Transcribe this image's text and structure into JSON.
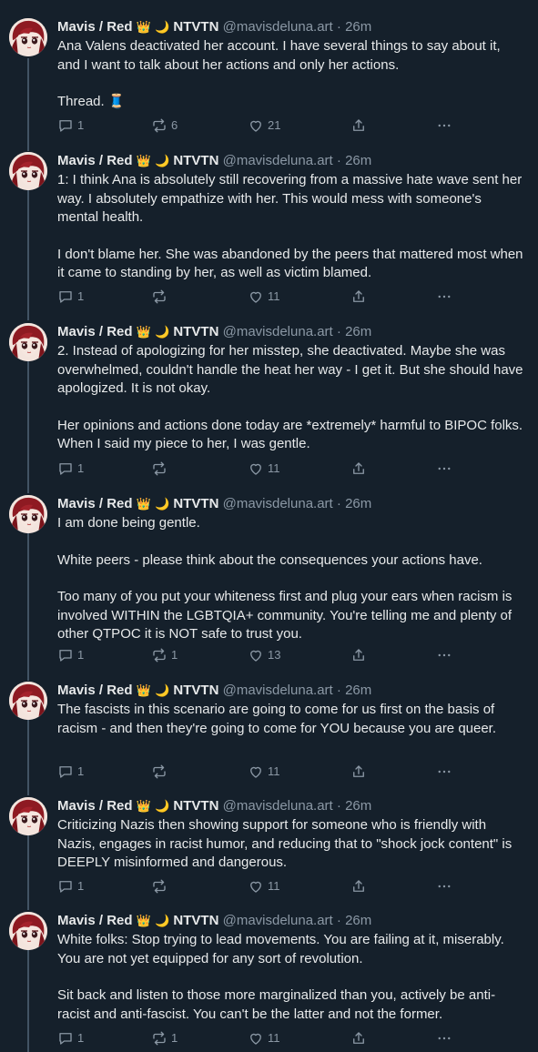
{
  "author": {
    "name": "Mavis / Red",
    "badge_emojis": [
      "👑",
      "🌙"
    ],
    "badge_text": "NTVTN",
    "handle": "@mavisdeluna.art",
    "separator": "·",
    "time": "26m"
  },
  "icons": {
    "reply": "reply-icon",
    "retweet": "retweet-icon",
    "like": "heart-icon",
    "share": "share-icon",
    "more": "more-icon"
  },
  "colors": {
    "background": "#15202b",
    "text": "#e7e9ea",
    "muted": "#8b98a5",
    "thread_line": "#425364"
  },
  "posts": [
    {
      "paragraphs": [
        "Ana Valens deactivated her account. I have several things to say about it, and I want to talk about her actions and only her actions.",
        "Thread. 🧵"
      ],
      "replies": "1",
      "retweets": "6",
      "likes": "21"
    },
    {
      "paragraphs": [
        "1: I think Ana is absolutely still recovering from a massive hate wave sent her way. I absolutely empathize with her. This would mess with someone's mental health.",
        "I don't blame her. She was abandoned by the peers that mattered most when it came to standing by her, as well as victim blamed."
      ],
      "replies": "1",
      "retweets": "",
      "likes": "11"
    },
    {
      "paragraphs": [
        "2. Instead of apologizing for her misstep, she deactivated. Maybe she was overwhelmed, couldn't handle the heat her way - I get it. But she should have apologized. It is not okay.",
        "Her opinions and actions done today are *extremely* harmful to BIPOC folks. When I said my piece to her, I was gentle."
      ],
      "replies": "1",
      "retweets": "",
      "likes": "11"
    },
    {
      "paragraphs": [
        "I am done being gentle.",
        "White peers - please think about the consequences your actions have.",
        "Too many of you put your whiteness first and plug your ears when racism is involved WITHIN the LGBTQIA+ community. You're telling me and plenty of other QTPOC it is NOT safe to trust you."
      ],
      "replies": "1",
      "retweets": "1",
      "likes": "13"
    },
    {
      "paragraphs": [
        "The fascists in this scenario are going to come for us first on the basis of racism - and then they're going to come for YOU because you are queer."
      ],
      "replies": "1",
      "retweets": "",
      "likes": "11"
    },
    {
      "paragraphs": [
        "Criticizing Nazis then showing support for someone who is friendly with Nazis, engages in racist humor, and reducing that to \"shock jock content\" is DEEPLY misinformed and dangerous."
      ],
      "replies": "1",
      "retweets": "",
      "likes": "11"
    },
    {
      "paragraphs": [
        "White folks: Stop trying to lead movements. You are failing at it, miserably. You are not yet equipped for any sort of revolution.",
        "Sit back and listen to those more marginalized than you, actively be anti-racist and anti-fascist. You can't be the latter and not the former."
      ],
      "replies": "1",
      "retweets": "1",
      "likes": "11"
    }
  ]
}
